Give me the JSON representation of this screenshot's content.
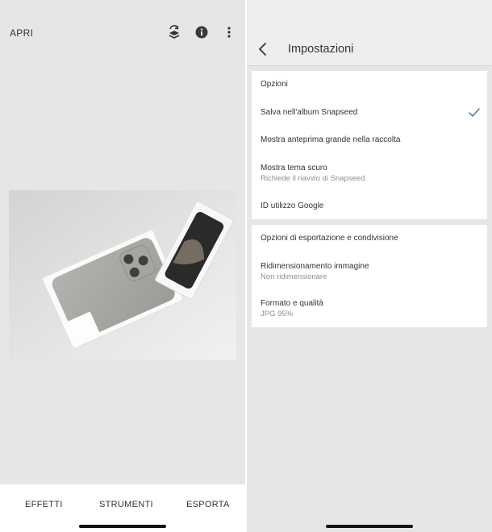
{
  "left": {
    "open_label": "APRI",
    "icons": [
      "layers-undo-icon",
      "info-icon",
      "more-vert-icon"
    ],
    "photo_alt": "",
    "tabs": [
      {
        "label": "EFFETTI"
      },
      {
        "label": "STRUMENTI"
      },
      {
        "label": "ESPORTA"
      }
    ]
  },
  "right": {
    "title": "Impostazioni",
    "sections": [
      {
        "header": "Opzioni",
        "items": [
          {
            "label": "Salva nell'album Snapseed",
            "sub": "",
            "checked": true
          },
          {
            "label": "Mostra anteprima grande nella raccolta",
            "sub": "",
            "checked": false
          },
          {
            "label": "Mostra tema scuro",
            "sub": "Richiede il riavvio di Snapseed.",
            "checked": false
          },
          {
            "label": "ID utilizzo Google",
            "sub": "",
            "checked": false
          }
        ]
      },
      {
        "header": "Opzioni di esportazione e condivisione",
        "items": [
          {
            "label": "Ridimensionamento immagine",
            "sub": "Non ridimensionare"
          },
          {
            "label": "Formato e qualità",
            "sub": "JPG 95%"
          }
        ]
      }
    ]
  },
  "colors": {
    "accent": "#3b6fb6",
    "background": "#e6e6e6",
    "card": "#ffffff",
    "subtext": "#8f8f8f"
  }
}
